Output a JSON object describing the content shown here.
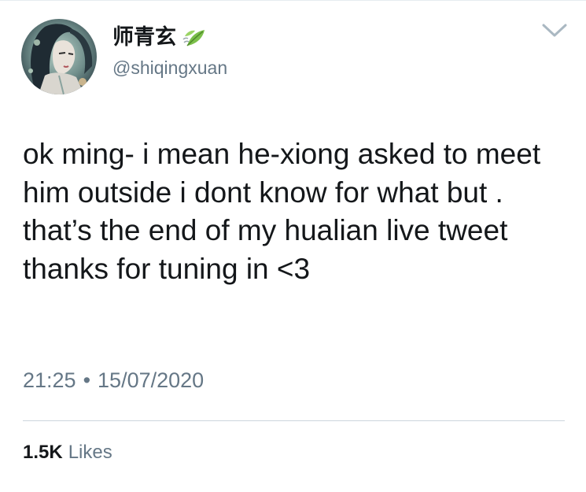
{
  "user": {
    "display_name": "师青玄",
    "handle": "@shiqingxuan",
    "name_emoji": "leaf-fluttering-in-wind-emoji"
  },
  "tweet": {
    "text": "ok ming- i mean he-xiong asked to meet him outside i dont know for what but . that’s the end of my hualian live tweet thanks for tuning in <3",
    "time": "21:25",
    "separator": "•",
    "date": "15/07/2020"
  },
  "stats": {
    "likes_count": "1.5K",
    "likes_label": "Likes"
  },
  "icons": {
    "menu": "chevron-down-icon"
  },
  "colors": {
    "primary_text": "#14171a",
    "secondary_text": "#657786",
    "divider": "#ccd6dd"
  }
}
